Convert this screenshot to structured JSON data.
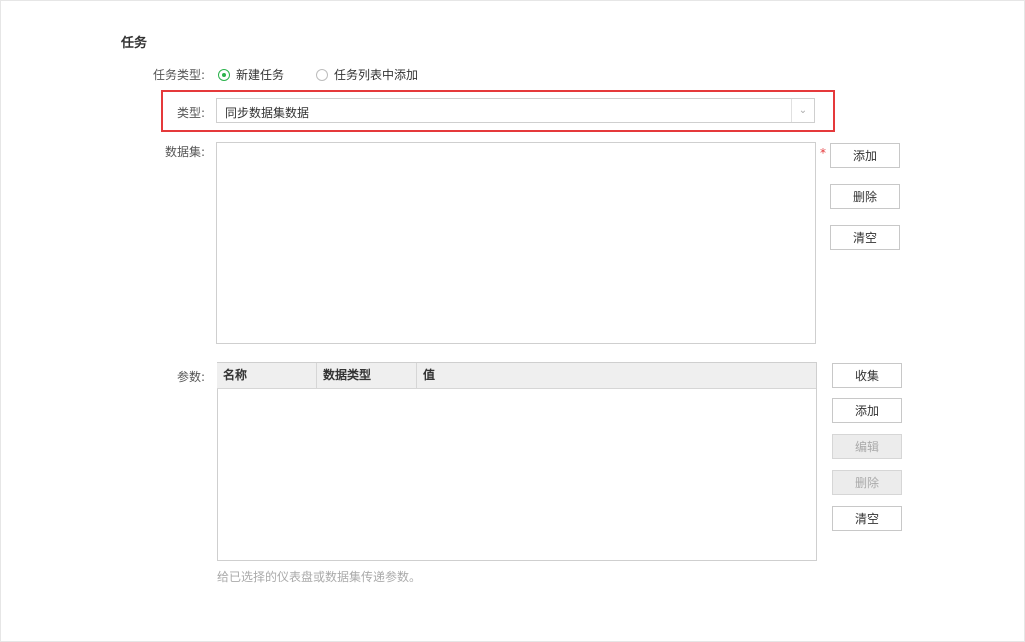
{
  "section": {
    "title": "任务"
  },
  "task_type": {
    "label": "任务类型:",
    "options": [
      {
        "label": "新建任务",
        "selected": true
      },
      {
        "label": "任务列表中添加",
        "selected": false
      }
    ]
  },
  "type": {
    "label": "类型:",
    "value": "同步数据集数据"
  },
  "dataset": {
    "label": "数据集:",
    "required_mark": "*",
    "buttons": {
      "add": "添加",
      "delete": "删除",
      "clear": "清空"
    }
  },
  "params": {
    "label": "参数:",
    "columns": [
      "名称",
      "数据类型",
      "值"
    ],
    "rows": [],
    "buttons": {
      "collect": "收集",
      "add": "添加",
      "edit": "编辑",
      "delete": "删除",
      "clear": "清空"
    },
    "hint": "给已选择的仪表盘或数据集传递参数。"
  },
  "colors": {
    "accent": "#2bb24c",
    "highlight": "#e5393b"
  }
}
